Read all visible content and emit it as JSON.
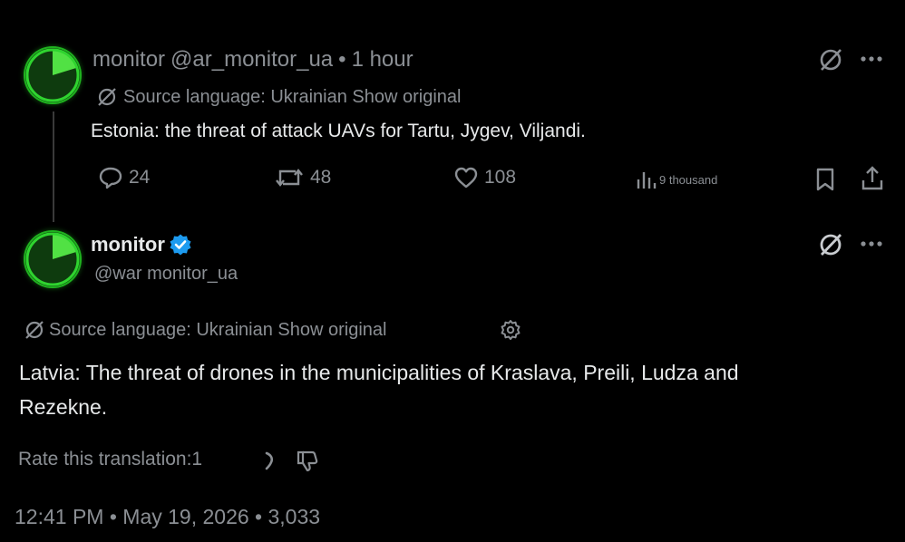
{
  "tweet1": {
    "display_name": "monitor",
    "handle": "@ar_monitor_ua",
    "separator": "•",
    "time": "1 hour",
    "translation_note": "Source language: Ukrainian Show original",
    "body": "Estonia: the threat of attack UAVs for Tartu, Jygev, Viljandi.",
    "replies": "24",
    "reposts": "48",
    "likes": "108",
    "views": "9 thousand"
  },
  "tweet2": {
    "display_name": "monitor",
    "handle": "@war monitor_ua",
    "translation_note": "Source language: Ukrainian Show original",
    "body_line1": "Latvia: The threat of drones in the municipalities of Kraslava, Preili, Ludza and",
    "body_line2": "Rezekne.",
    "rate_label": "Rate this translation:1",
    "meta": "12:41 PM • May 19, 2026 • 3,033"
  },
  "colors": {
    "background": "#000000",
    "text": "#e7e9ea",
    "muted": "#8b8f94",
    "verified": "#1d9bf0",
    "avatar_green": "#1fb21f"
  }
}
